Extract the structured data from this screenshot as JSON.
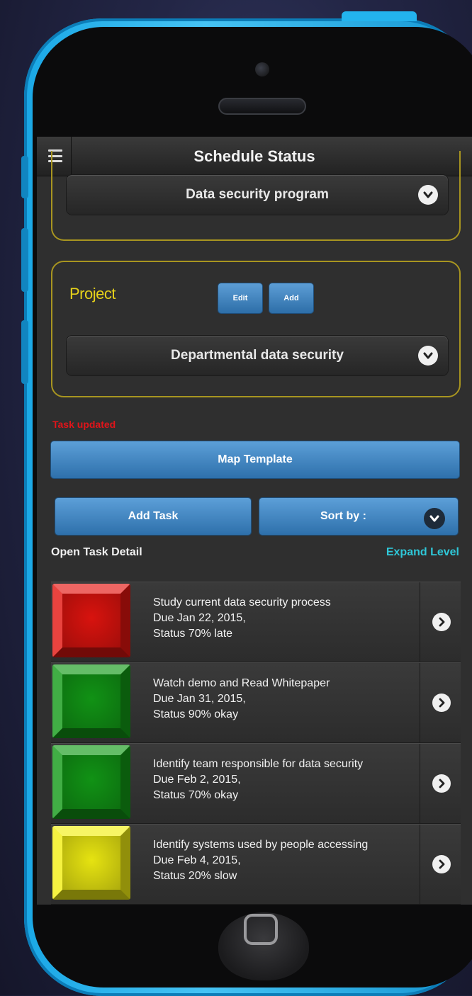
{
  "header": {
    "title": "Schedule Status"
  },
  "program": {
    "selected": "Data security program"
  },
  "project": {
    "label": "Project",
    "edit_label": "Edit",
    "add_label": "Add",
    "selected": "Departmental data security"
  },
  "status_message": "Task updated",
  "actions": {
    "map_template_label": "Map Template",
    "add_task_label": "Add Task",
    "sort_by_label": "Sort by :"
  },
  "task_section": {
    "open_task_detail_label": "Open Task Detail",
    "expand_level_label": "Expand Level"
  },
  "tasks": [
    {
      "title": "Study current data security process",
      "due": "Due Jan 22, 2015,",
      "status": "Status 70% late",
      "color": "#e3140f"
    },
    {
      "title": "Watch demo and Read Whitepaper",
      "due": "Due Jan 31, 2015,",
      "status": "Status 90% okay",
      "color": "#129a16"
    },
    {
      "title": "Identify team responsible for data security",
      "due": "Due Feb 2, 2015,",
      "status": "Status 70% okay",
      "color": "#129a16"
    },
    {
      "title": "Identify systems used by people accessing",
      "due": "Due Feb 4, 2015,",
      "status": "Status 20% slow",
      "color": "#f2ef12"
    }
  ],
  "colors": {
    "accent_blue": "#3b82c2",
    "panel_border": "#a89520",
    "project_label": "#e6d21a",
    "error_text": "#e0141a",
    "link": "#2fc7d8"
  },
  "icons": [
    "menu-icon",
    "chevron-down-icon",
    "chevron-right-icon"
  ]
}
